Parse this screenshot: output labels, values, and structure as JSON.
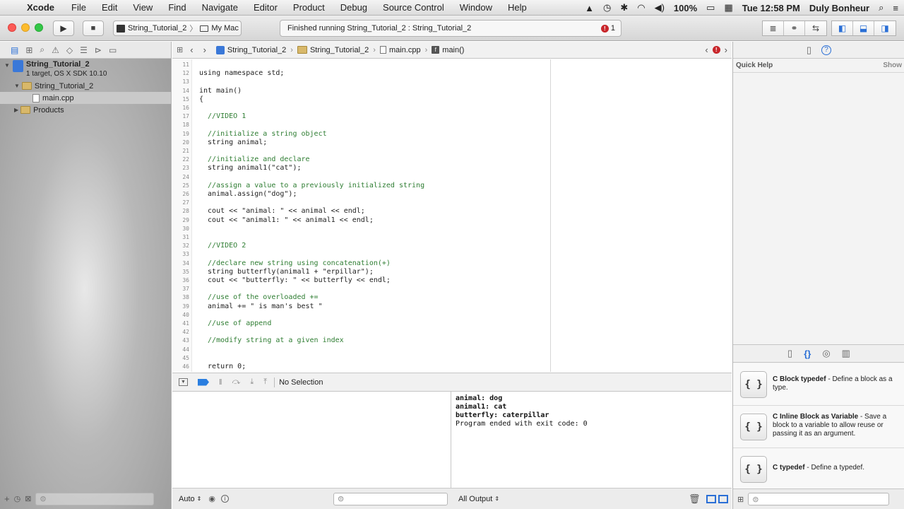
{
  "menubar": {
    "apple": "",
    "app": "Xcode",
    "items": [
      "File",
      "Edit",
      "View",
      "Find",
      "Navigate",
      "Editor",
      "Product",
      "Debug",
      "Source Control",
      "Window",
      "Help"
    ],
    "battery": "100%",
    "clock": "Tue 12:58 PM",
    "user": "Duly Bonheur"
  },
  "toolbar": {
    "scheme": "String_Tutorial_2",
    "destination": "My Mac",
    "activity": "Finished running String_Tutorial_2 : String_Tutorial_2",
    "error_count": "1"
  },
  "navigator": {
    "project_name": "String_Tutorial_2",
    "project_sub": "1 target, OS X SDK 10.10",
    "group_name": "String_Tutorial_2",
    "file_name": "main.cpp",
    "products": "Products"
  },
  "jumpbar": {
    "crumbs": [
      "String_Tutorial_2",
      "String_Tutorial_2",
      "main.cpp",
      "main()"
    ]
  },
  "editor": {
    "line_numbers": [
      "11",
      "12",
      "13",
      "14",
      "15",
      "16",
      "17",
      "18",
      "19",
      "20",
      "21",
      "22",
      "23",
      "24",
      "25",
      "26",
      "27",
      "28",
      "29",
      "30",
      "31",
      "32",
      "33",
      "34",
      "35",
      "36",
      "37",
      "38",
      "39",
      "40",
      "41",
      "42",
      "43",
      "44",
      "45",
      "46"
    ],
    "lines": [
      "",
      "using namespace std;",
      "",
      "int main()",
      "{",
      "",
      "  //VIDEO 1",
      "",
      "  //initialize a string object",
      "  string animal;",
      "",
      "  //initialize and declare",
      "  string animal1(\"cat\");",
      "",
      "  //assign a value to a previously initialized string",
      "  animal.assign(\"dog\");",
      "",
      "  cout << \"animal: \" << animal << endl;",
      "  cout << \"animal1: \" << animal1 << endl;",
      "",
      "",
      "  //VIDEO 2",
      "",
      "  //declare new string using concatenation(+)",
      "  string butterfly(animal1 + \"erpillar\");",
      "  cout << \"butterfly: \" << butterfly << endl;",
      "",
      "  //use of the overloaded +=",
      "  animal += \" is man's best \"",
      "",
      "  //use of append",
      "",
      "  //modify string at a given index",
      "",
      "",
      "  return 0;"
    ]
  },
  "debugbar": {
    "selection": "No Selection"
  },
  "console": {
    "lines": [
      "animal: dog",
      "animal1: cat",
      "butterfly: caterpillar",
      "Program ended with exit code: 0"
    ],
    "output_label": "All Output"
  },
  "variables": {
    "scope_label": "Auto"
  },
  "utilities": {
    "quick_help": "Quick Help",
    "show": "Show",
    "library": [
      {
        "title": "C Block typedef",
        "desc": " - Define a block as a type."
      },
      {
        "title": "C Inline Block as Variable",
        "desc": " - Save a block to a variable to allow reuse or passing it as an argument."
      },
      {
        "title": "C typedef",
        "desc": " - Define a typedef."
      }
    ],
    "lib_icon": "{ }"
  },
  "colors": {
    "comment": "#2e7d32",
    "keyword": "#7a2d9c",
    "error": "#c8262b",
    "selection_blue": "#2a6fd6"
  }
}
